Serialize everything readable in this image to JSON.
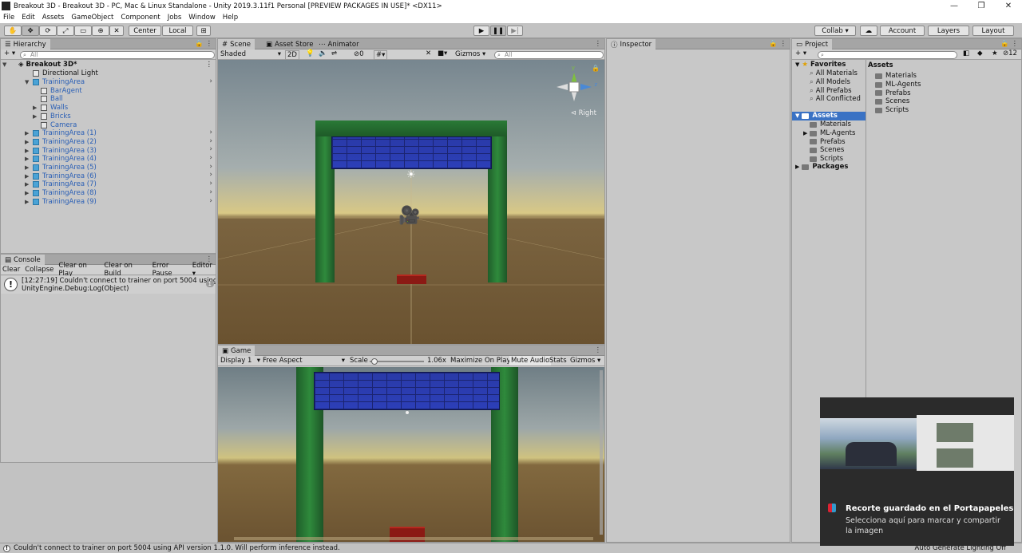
{
  "window": {
    "title": "Breakout 3D - Breakout 3D - PC, Mac & Linux Standalone - Unity 2019.3.11f1 Personal [PREVIEW PACKAGES IN USE]* <DX11>",
    "buttons": {
      "minimize": "—",
      "maximize": "❐",
      "close": "✕"
    }
  },
  "menu": [
    "File",
    "Edit",
    "Assets",
    "GameObject",
    "Component",
    "Jobs",
    "Window",
    "Help"
  ],
  "toolbar": {
    "center": "Center",
    "local": "Local",
    "collab": "Collab ▾",
    "account": "Account",
    "layers": "Layers",
    "layout": "Layout"
  },
  "hierarchy": {
    "tab": "Hierarchy",
    "search_placeholder": "All",
    "scene": "Breakout 3D*",
    "items": [
      {
        "label": "Directional Light",
        "blue": false
      },
      {
        "label": "TrainingArea",
        "blue": true
      },
      {
        "label": "BarAgent",
        "blue": true
      },
      {
        "label": "Ball",
        "blue": true
      },
      {
        "label": "Walls",
        "blue": true
      },
      {
        "label": "Bricks",
        "blue": true
      },
      {
        "label": "Camera",
        "blue": true
      },
      {
        "label": "TrainingArea (1)",
        "blue": true
      },
      {
        "label": "TrainingArea (2)",
        "blue": true
      },
      {
        "label": "TrainingArea (3)",
        "blue": true
      },
      {
        "label": "TrainingArea (4)",
        "blue": true
      },
      {
        "label": "TrainingArea (5)",
        "blue": true
      },
      {
        "label": "TrainingArea (6)",
        "blue": true
      },
      {
        "label": "TrainingArea (7)",
        "blue": true
      },
      {
        "label": "TrainingArea (8)",
        "blue": true
      },
      {
        "label": "TrainingArea (9)",
        "blue": true
      }
    ]
  },
  "console": {
    "tab": "Console",
    "buttons": [
      "Clear",
      "Collapse",
      "Clear on Play",
      "Clear on Build",
      "Error Pause",
      "Editor ▾"
    ],
    "message_line1": "[12:27:19] Couldn't connect to trainer on port 5004 using API versi",
    "message_line2": "UnityEngine.Debug:Log(Object)",
    "count": "1"
  },
  "scene": {
    "tabs": [
      "Scene",
      "Asset Store",
      "Animator"
    ],
    "shading": "Shaded",
    "mode2d": "2D",
    "hidden_count": "0",
    "gizmos": "Gizmos",
    "search_placeholder": "All",
    "gizmo_label": "Right",
    "gizmo_y": "y",
    "gizmo_z": "z"
  },
  "game": {
    "tab": "Game",
    "display": "Display 1",
    "aspect": "Free Aspect",
    "scale_label": "Scale",
    "scale_value": "1.06x",
    "scale_fraction": 0.03,
    "maximize": "Maximize On Play",
    "mute": "Mute Audio",
    "stats": "Stats",
    "gizmos": "Gizmos"
  },
  "inspector": {
    "tab": "Inspector"
  },
  "project": {
    "tab": "Project",
    "badge": "12",
    "favorites_label": "Favorites",
    "favorites": [
      "All Materials",
      "All Models",
      "All Prefabs",
      "All Conflicted"
    ],
    "assets_label": "Assets",
    "asset_folders": [
      "Materials",
      "ML-Agents",
      "Prefabs",
      "Scenes",
      "Scripts"
    ],
    "packages_label": "Packages",
    "right_header": "Assets",
    "right_items": [
      "Materials",
      "ML-Agents",
      "Prefabs",
      "Scenes",
      "Scripts"
    ]
  },
  "statusbar": {
    "message": "Couldn't connect to trainer on port 5004 using API version 1.1.0. Will perform inference instead.",
    "right": "Auto Generate Lighting Off"
  },
  "toast": {
    "title": "Recorte guardado en el Portapapeles",
    "body": "Selecciona aquí para marcar y compartir la imagen"
  },
  "colors": {
    "selection": "#3a72c4",
    "post_green": "#2f8a3c",
    "bricks_blue": "#2a3aa8",
    "paddle_red": "#8b1a14"
  }
}
